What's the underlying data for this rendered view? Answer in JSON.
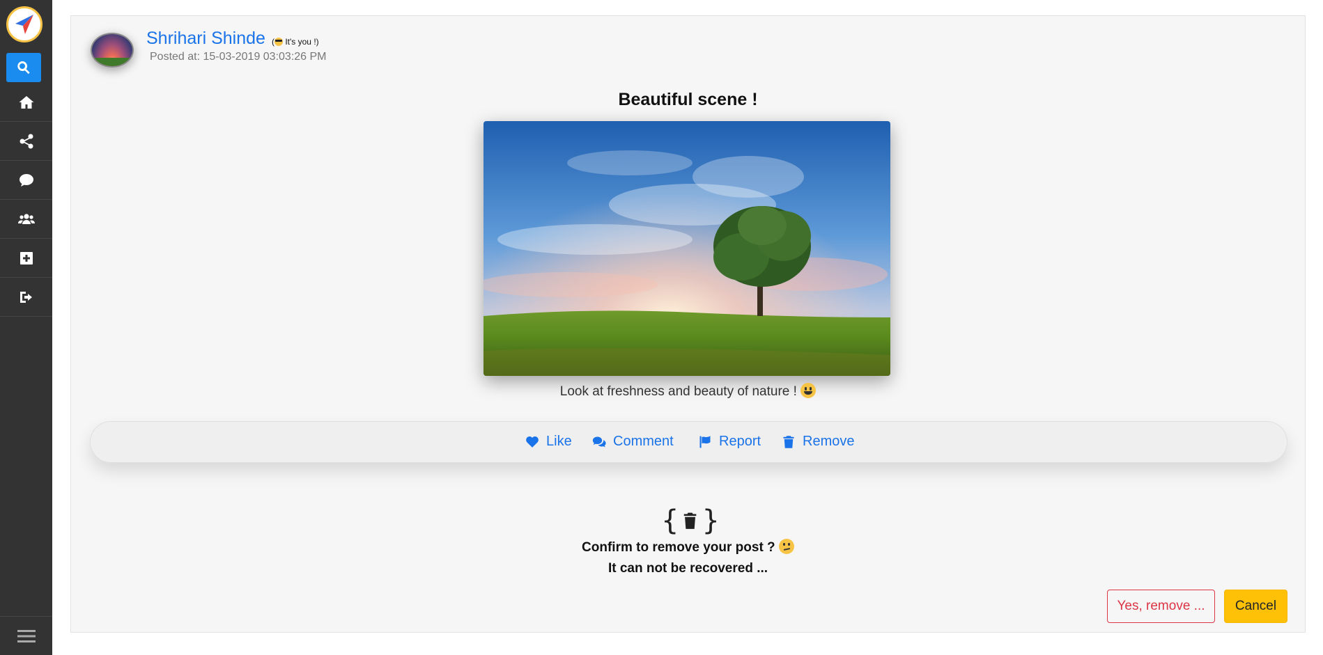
{
  "sidebar": {
    "items": [
      {
        "name": "search",
        "icon": "search-icon",
        "active": true
      },
      {
        "name": "home",
        "icon": "home-icon"
      },
      {
        "name": "share",
        "icon": "share-icon"
      },
      {
        "name": "chat",
        "icon": "comment-icon"
      },
      {
        "name": "users",
        "icon": "users-icon"
      },
      {
        "name": "add",
        "icon": "plus-square-icon"
      },
      {
        "name": "logout",
        "icon": "sign-out-icon"
      }
    ],
    "menu_icon": "bars-icon",
    "accent_color": "#1a8cf0"
  },
  "post": {
    "author": "Shrihari Shinde",
    "you_tag": "It's you !",
    "posted_at": "Posted at: 15-03-2019 03:03:26 PM",
    "title": "Beautiful scene !",
    "caption": "Look at freshness and beauty of nature !"
  },
  "actions": {
    "like": "Like",
    "comment": "Comment",
    "report": "Report",
    "remove": "Remove"
  },
  "confirm": {
    "line1": "Confirm to remove your post ?",
    "line2": "It can not be recovered ...",
    "yes_label": "Yes, remove ...",
    "cancel_label": "Cancel"
  }
}
